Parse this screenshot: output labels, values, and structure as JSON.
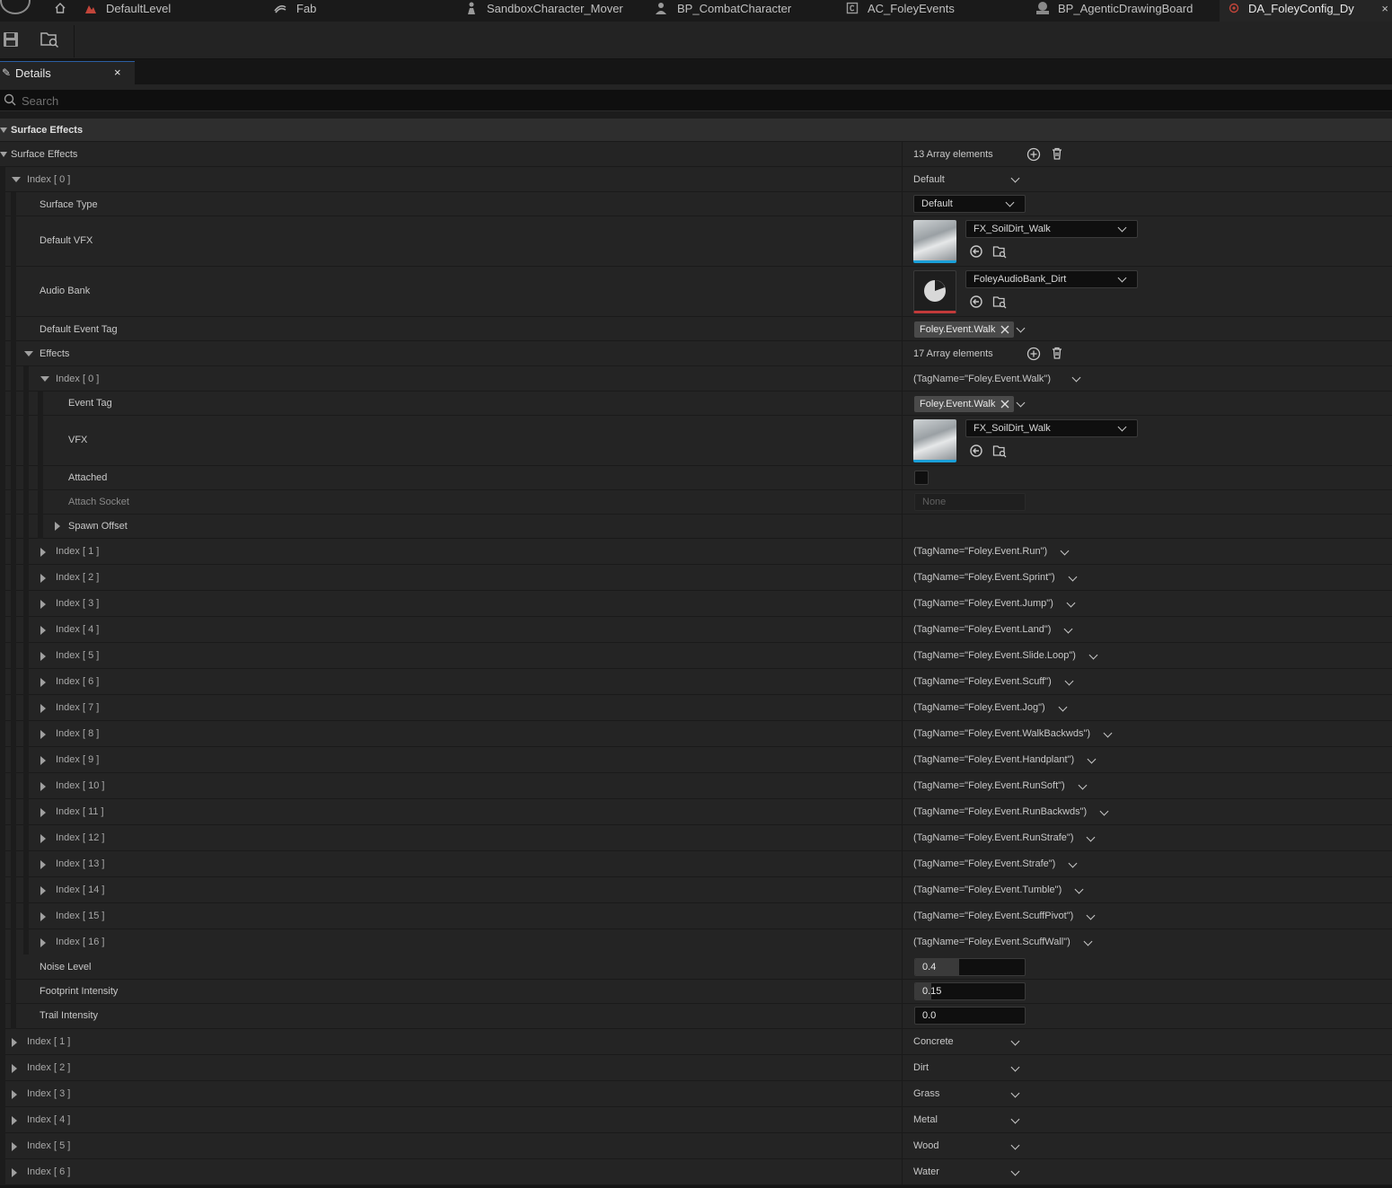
{
  "tabs": [
    {
      "label": "DefaultLevel",
      "icon": "level-icon",
      "active": false
    },
    {
      "label": "Fab",
      "icon": "fab-icon",
      "active": false
    },
    {
      "label": "SandboxCharacter_Mover",
      "icon": "character-icon",
      "active": false
    },
    {
      "label": "BP_CombatCharacter",
      "icon": "character-icon",
      "active": false
    },
    {
      "label": "AC_FoleyEvents",
      "icon": "component-icon",
      "active": false
    },
    {
      "label": "BP_AgenticDrawingBoard",
      "icon": "blueprint-icon",
      "active": false
    },
    {
      "label": "DA_FoleyConfig_Dy",
      "icon": "data-asset-icon",
      "active": true
    }
  ],
  "panel": {
    "title": "Details",
    "close_glyph": "×",
    "search_placeholder": "Search"
  },
  "category": {
    "label": "Surface Effects"
  },
  "surface_effects": {
    "label": "Surface Effects",
    "count_label": "13 Array elements",
    "index0": {
      "label": "Index [ 0 ]",
      "value": "Default",
      "surface_type": {
        "label": "Surface Type",
        "value": "Default"
      },
      "default_vfx": {
        "label": "Default VFX",
        "asset": "FX_SoilDirt_Walk"
      },
      "audio_bank": {
        "label": "Audio Bank",
        "asset": "FoleyAudioBank_Dirt"
      },
      "default_event_tag": {
        "label": "Default Event Tag",
        "tag": "Foley.Event.Walk"
      },
      "effects": {
        "label": "Effects",
        "count_label": "17 Array elements",
        "index0": {
          "label": "Index [ 0 ]",
          "value": "(TagName=\"Foley.Event.Walk\")",
          "event_tag": {
            "label": "Event Tag",
            "tag": "Foley.Event.Walk"
          },
          "vfx": {
            "label": "VFX",
            "asset": "FX_SoilDirt_Walk"
          },
          "attached": {
            "label": "Attached",
            "checked": false
          },
          "attach_socket": {
            "label": "Attach Socket",
            "value": "None"
          },
          "spawn_offset": {
            "label": "Spawn Offset"
          }
        },
        "items": [
          {
            "label": "Index [ 1 ]",
            "value": "(TagName=\"Foley.Event.Run\")"
          },
          {
            "label": "Index [ 2 ]",
            "value": "(TagName=\"Foley.Event.Sprint\")"
          },
          {
            "label": "Index [ 3 ]",
            "value": "(TagName=\"Foley.Event.Jump\")"
          },
          {
            "label": "Index [ 4 ]",
            "value": "(TagName=\"Foley.Event.Land\")"
          },
          {
            "label": "Index [ 5 ]",
            "value": "(TagName=\"Foley.Event.Slide.Loop\")"
          },
          {
            "label": "Index [ 6 ]",
            "value": "(TagName=\"Foley.Event.Scuff\")"
          },
          {
            "label": "Index [ 7 ]",
            "value": "(TagName=\"Foley.Event.Jog\")"
          },
          {
            "label": "Index [ 8 ]",
            "value": "(TagName=\"Foley.Event.WalkBackwds\")"
          },
          {
            "label": "Index [ 9 ]",
            "value": "(TagName=\"Foley.Event.Handplant\")"
          },
          {
            "label": "Index [ 10 ]",
            "value": "(TagName=\"Foley.Event.RunSoft\")"
          },
          {
            "label": "Index [ 11 ]",
            "value": "(TagName=\"Foley.Event.RunBackwds\")"
          },
          {
            "label": "Index [ 12 ]",
            "value": "(TagName=\"Foley.Event.RunStrafe\")"
          },
          {
            "label": "Index [ 13 ]",
            "value": "(TagName=\"Foley.Event.Strafe\")"
          },
          {
            "label": "Index [ 14 ]",
            "value": "(TagName=\"Foley.Event.Tumble\")"
          },
          {
            "label": "Index [ 15 ]",
            "value": "(TagName=\"Foley.Event.ScuffPivot\")"
          },
          {
            "label": "Index [ 16 ]",
            "value": "(TagName=\"Foley.Event.ScuffWall\")"
          }
        ]
      },
      "noise_level": {
        "label": "Noise Level",
        "value": "0.4",
        "fill": 0.4
      },
      "footprint_intensity": {
        "label": "Footprint Intensity",
        "value": "0.15",
        "fill": 0.15
      },
      "trail_intensity": {
        "label": "Trail Intensity",
        "value": "0.0",
        "fill": 0.0
      }
    },
    "items": [
      {
        "label": "Index [ 1 ]",
        "value": "Concrete"
      },
      {
        "label": "Index [ 2 ]",
        "value": "Dirt"
      },
      {
        "label": "Index [ 3 ]",
        "value": "Grass"
      },
      {
        "label": "Index [ 4 ]",
        "value": "Metal"
      },
      {
        "label": "Index [ 5 ]",
        "value": "Wood"
      },
      {
        "label": "Index [ 6 ]",
        "value": "Water"
      }
    ]
  },
  "colors": {
    "accent_blue": "#1a9fd8",
    "audio_red": "#c23a3a",
    "panel_bg": "#242424",
    "category_bg": "#2e2e2e"
  }
}
